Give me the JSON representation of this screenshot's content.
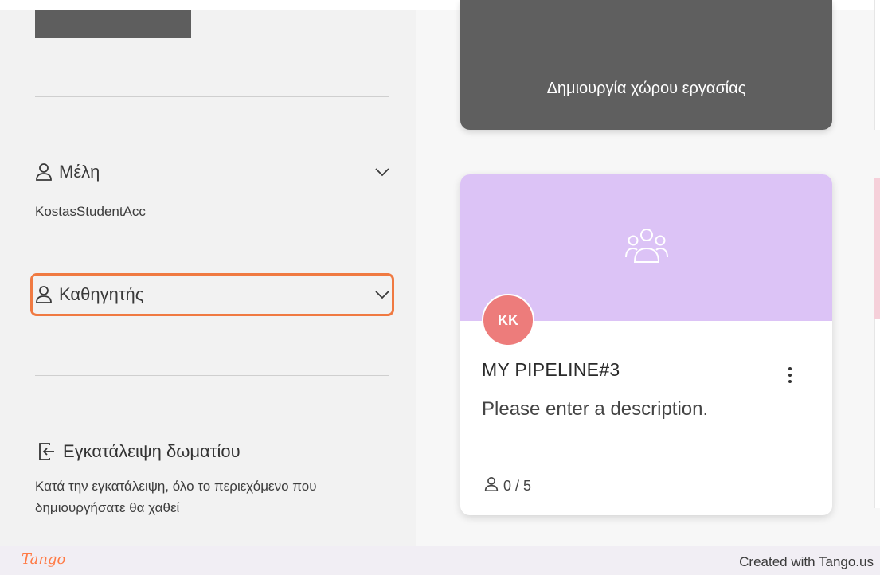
{
  "sidebar": {
    "members": {
      "title": "Μέλη",
      "value": "KostasStudentAcc"
    },
    "teacher": {
      "title": "Καθηγητής"
    },
    "leave": {
      "title": "Εγκατάλειψη δωματίου",
      "description": "Κατά την εγκατάλειψη, όλο το περιεχόμενο που δημιουργήσατε θα χαθεί"
    }
  },
  "main": {
    "create_workspace_label": "Δημιουργία χώρου εργασίας",
    "card": {
      "avatar_initials": "KK",
      "title": "MY PIPELINE#3",
      "description": "Please enter a description.",
      "members_count": "0 / 5",
      "banner_color": "#dcc3f6",
      "avatar_color": "#ed7c7b",
      "group_icon": "group-icon",
      "menu_icon": "more-vertical-icon"
    }
  },
  "highlight_color": "#f07a42",
  "footer": {
    "logo": "Tango",
    "credit": "Created with Tango.us"
  }
}
